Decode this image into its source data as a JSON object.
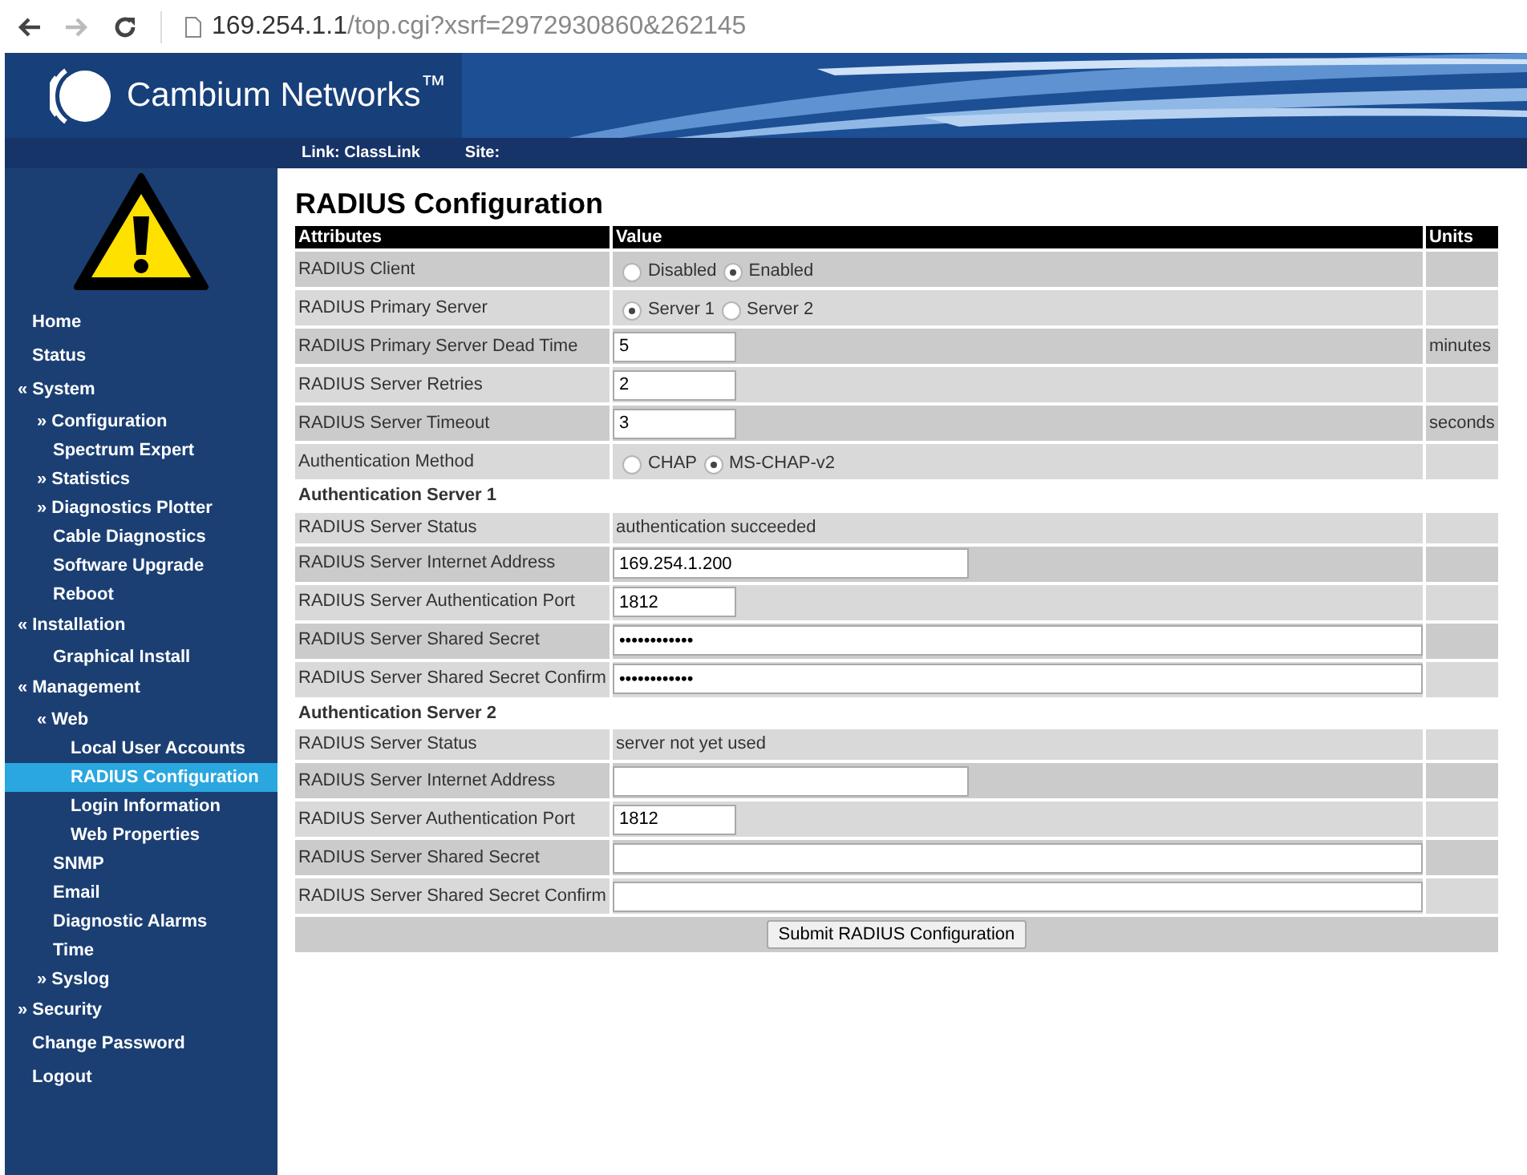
{
  "browser": {
    "url_host": "169.254.1.1",
    "url_path": "/top.cgi?xsrf=2972930860&262145"
  },
  "header": {
    "brand": "Cambium Networks$^{™}$",
    "link_label": "Link: ClassLink",
    "site_label": "Site:"
  },
  "sidebar": {
    "items": [
      {
        "label": "Home",
        "selected": false
      },
      {
        "label": "Status",
        "selected": false
      },
      {
        "label": "System",
        "marker": "«",
        "selected": false,
        "children": [
          {
            "label": "Configuration",
            "marker": "»",
            "selected": false
          },
          {
            "label": "Spectrum Expert",
            "selected": false
          },
          {
            "label": "Statistics",
            "marker": "»",
            "selected": false
          },
          {
            "label": "Diagnostics Plotter",
            "marker": "»",
            "selected": false
          },
          {
            "label": "Cable Diagnostics",
            "selected": false
          },
          {
            "label": "Software Upgrade",
            "selected": false
          },
          {
            "label": "Reboot",
            "selected": false
          }
        ]
      },
      {
        "label": "Installation",
        "marker": "«",
        "selected": false,
        "children": [
          {
            "label": "Graphical Install",
            "selected": false
          }
        ]
      },
      {
        "label": "Management",
        "marker": "«",
        "selected": false,
        "children": [
          {
            "label": "Web",
            "marker": "«",
            "selected": false,
            "children": [
              {
                "label": "Local User Accounts",
                "selected": false
              },
              {
                "label": "RADIUS Configuration",
                "selected": true
              },
              {
                "label": "Login Information",
                "selected": false
              },
              {
                "label": "Web Properties",
                "selected": false
              }
            ]
          },
          {
            "label": "SNMP",
            "selected": false
          },
          {
            "label": "Email",
            "selected": false
          },
          {
            "label": "Diagnostic Alarms",
            "selected": false
          },
          {
            "label": "Time",
            "selected": false
          },
          {
            "label": "Syslog",
            "marker": "»",
            "selected": false
          }
        ]
      },
      {
        "label": "Security",
        "marker": "»",
        "selected": false
      },
      {
        "label": "Change Password",
        "selected": false
      },
      {
        "label": "Logout",
        "selected": false
      }
    ]
  },
  "page": {
    "title": "RADIUS Configuration"
  },
  "table": {
    "columns": [
      "Attributes",
      "Value",
      "Units"
    ],
    "sections": [
      {
        "rows": [
          {
            "attribute": "RADIUS Client",
            "kind": "radio",
            "options": [
              {
                "label": "Disabled",
                "selected": false
              },
              {
                "label": "Enabled",
                "selected": true
              }
            ]
          },
          {
            "attribute": "RADIUS Primary Server",
            "kind": "radio",
            "options": [
              {
                "label": "Server 1",
                "selected": true
              },
              {
                "label": "Server 2",
                "selected": false
              }
            ]
          },
          {
            "attribute": "RADIUS Primary Server Dead Time",
            "kind": "short-field",
            "value": "5",
            "units": "minutes"
          },
          {
            "attribute": "RADIUS Server Retries",
            "kind": "short-field",
            "value": "2"
          },
          {
            "attribute": "RADIUS Server Timeout",
            "kind": "short-field",
            "value": "3",
            "units": "seconds"
          },
          {
            "attribute": "Authentication Method",
            "kind": "radio",
            "options": [
              {
                "label": "CHAP",
                "selected": false
              },
              {
                "label": "MS-CHAP-v2",
                "selected": true
              }
            ]
          }
        ]
      },
      {
        "heading": "Authentication Server 1",
        "rows": [
          {
            "attribute": "RADIUS Server Status",
            "kind": "status",
            "value": "authentication succeeded"
          },
          {
            "attribute": "RADIUS Server Internet Address",
            "kind": "medium-field",
            "value": "169.254.1.200"
          },
          {
            "attribute": "RADIUS Server Authentication Port",
            "kind": "short-field",
            "value": "1812"
          },
          {
            "attribute": "RADIUS Server Shared Secret",
            "kind": "wide-field",
            "value": "••••••••••••"
          },
          {
            "attribute": "RADIUS Server Shared Secret Confirm",
            "kind": "wide-field",
            "value": "••••••••••••"
          }
        ]
      },
      {
        "heading": "Authentication Server 2",
        "rows": [
          {
            "attribute": "RADIUS Server Status",
            "kind": "status",
            "value": "server not yet used"
          },
          {
            "attribute": "RADIUS Server Internet Address",
            "kind": "medium-field"
          },
          {
            "attribute": "RADIUS Server Authentication Port",
            "kind": "short-field",
            "value": "1812"
          },
          {
            "attribute": "RADIUS Server Shared Secret",
            "kind": "wide-field"
          },
          {
            "attribute": "RADIUS Server Shared Secret Confirm",
            "kind": "wide-field"
          }
        ]
      }
    ],
    "submit": "Submit RADIUS Configuration"
  }
}
